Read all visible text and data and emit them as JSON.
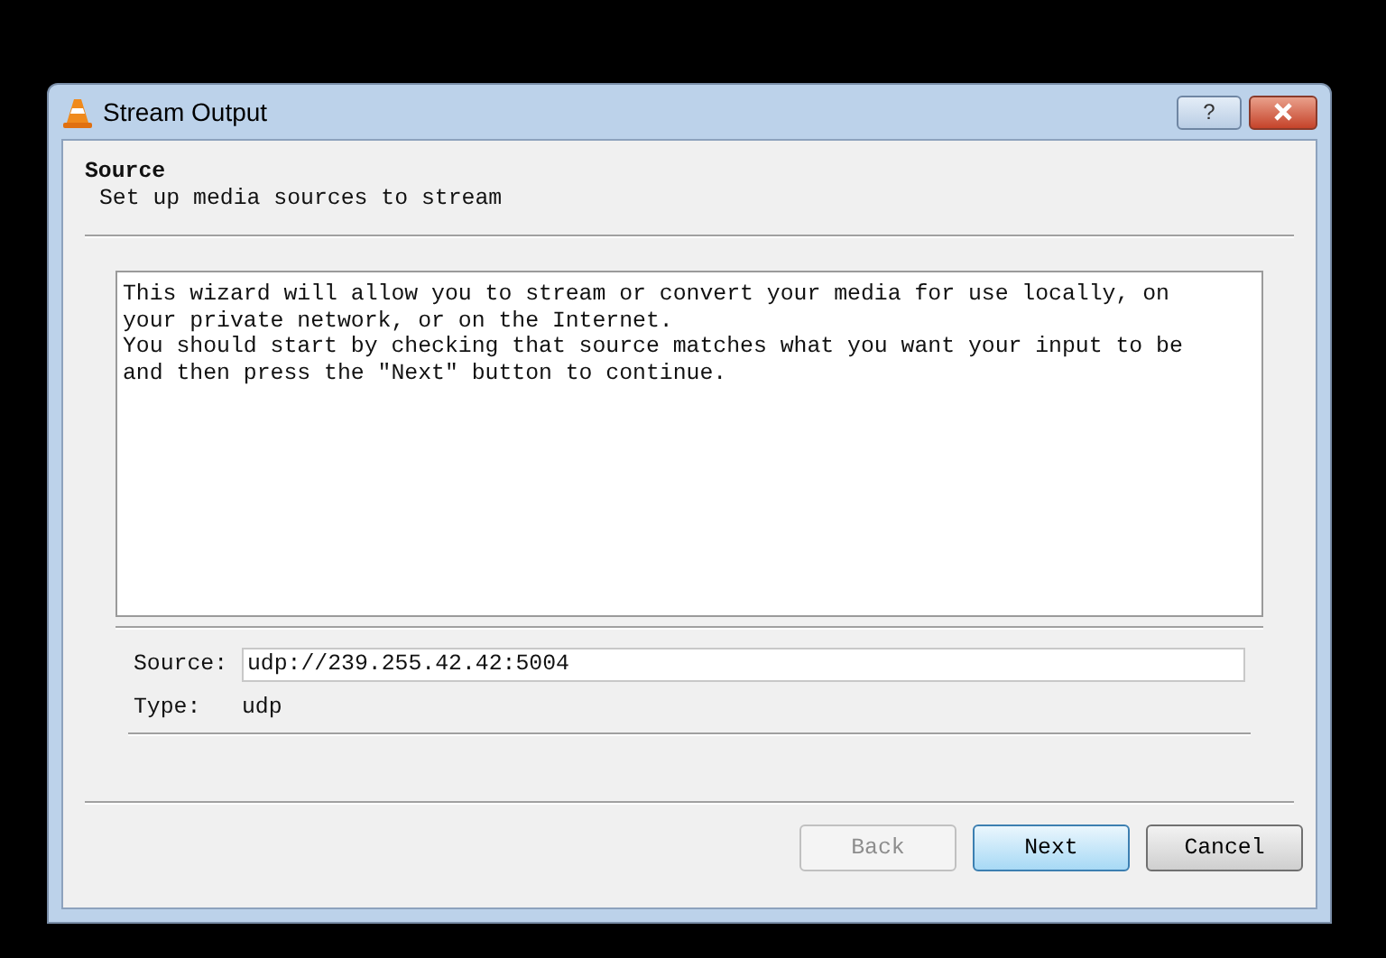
{
  "window": {
    "title": "Stream Output",
    "help_button": "?"
  },
  "header": {
    "title": "Source",
    "subtitle": "Set up media sources to stream"
  },
  "description": [
    "This wizard will allow you to stream or convert your media for use locally, on your private network, or on the Internet.",
    "You should start by checking that source matches what you want your input to be and then press the \"Next\" button to continue."
  ],
  "source": {
    "label": "Source:",
    "value": "udp://239.255.42.42:5004"
  },
  "type": {
    "label": "Type:",
    "value": "udp"
  },
  "buttons": [
    {
      "label": "Back",
      "disabled": true,
      "highlighted": false
    },
    {
      "label": "Next",
      "disabled": false,
      "highlighted": true
    },
    {
      "label": "Cancel",
      "disabled": false,
      "highlighted": false
    }
  ]
}
